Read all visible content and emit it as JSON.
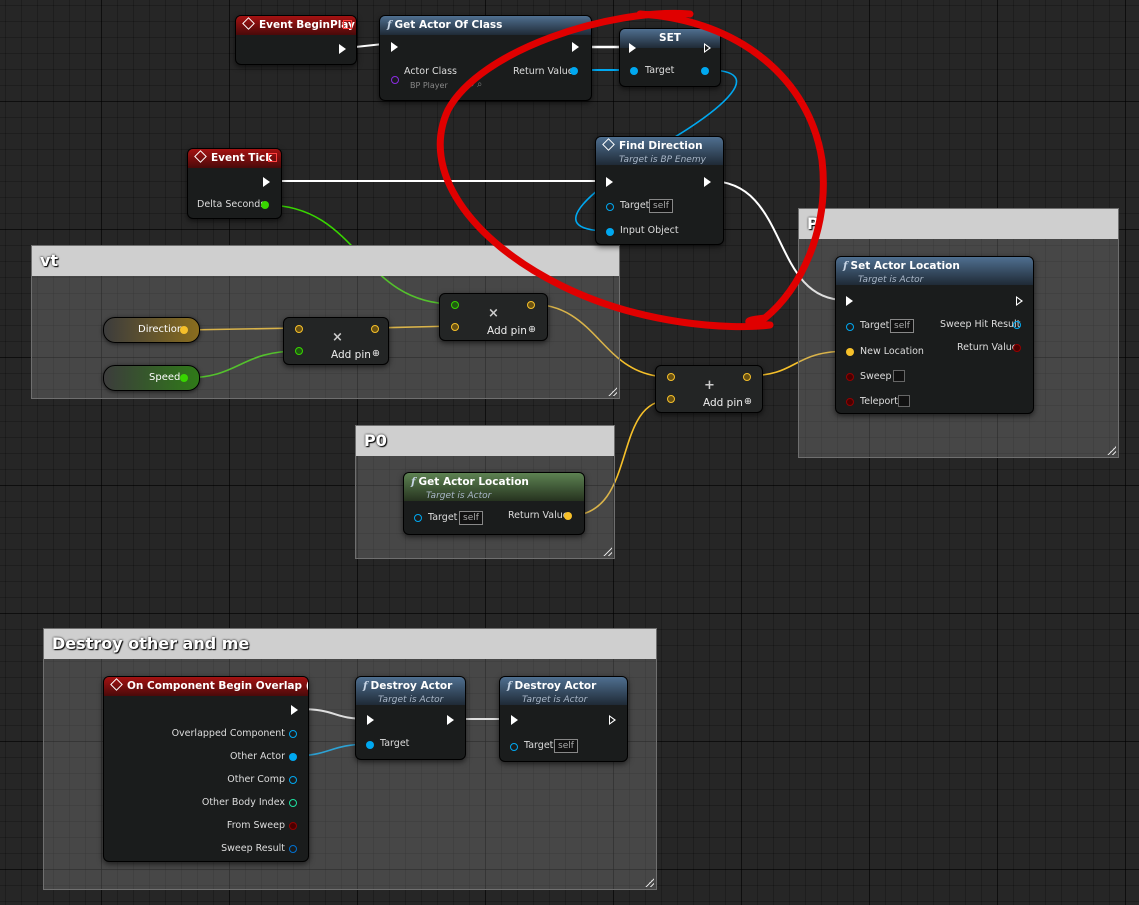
{
  "comments": {
    "vt": "vt",
    "p": "P",
    "p0": "P0",
    "destroy": "Destroy other and me"
  },
  "nodes": {
    "event_begin_play": {
      "title": "Event BeginPlay"
    },
    "get_actor_of_class": {
      "title": "Get Actor Of Class",
      "actor_class_label": "Actor Class",
      "actor_class_value": "BP Player",
      "return_value_label": "Return Value"
    },
    "set": {
      "title": "SET",
      "target_label": "Target"
    },
    "find_direction": {
      "title": "Find Direction",
      "subtitle": "Target is BP Enemy",
      "target_label": "Target",
      "target_value": "self",
      "input_object_label": "Input Object"
    },
    "event_tick": {
      "title": "Event Tick",
      "delta_seconds_label": "Delta Seconds"
    },
    "set_actor_location": {
      "title": "Set Actor Location",
      "subtitle": "Target is Actor",
      "target_label": "Target",
      "target_value": "self",
      "new_location_label": "New Location",
      "sweep_label": "Sweep",
      "teleport_label": "Teleport",
      "sweep_hit_result_label": "Sweep Hit Result",
      "return_value_label": "Return Value"
    },
    "get_actor_location": {
      "title": "Get Actor Location",
      "subtitle": "Target is Actor",
      "target_label": "Target",
      "target_value": "self",
      "return_value_label": "Return Value"
    },
    "on_component_begin_overlap": {
      "title": "On Component Begin Overlap (Box)",
      "pins": [
        "Overlapped Component",
        "Other Actor",
        "Other Comp",
        "Other Body Index",
        "From Sweep",
        "Sweep Result"
      ]
    },
    "destroy_actor_1": {
      "title": "Destroy Actor",
      "subtitle": "Target is Actor",
      "target_label": "Target"
    },
    "destroy_actor_2": {
      "title": "Destroy Actor",
      "subtitle": "Target is Actor",
      "target_label": "Target",
      "target_value": "self"
    }
  },
  "variables": {
    "direction": "Direction",
    "speed": "Speed"
  },
  "operators": {
    "multiply_sym": "×",
    "add_sym": "+",
    "add_pin_label": "Add pin"
  },
  "colors": {
    "exec": "#ffffff",
    "object": "#00a8f0",
    "vector": "#f6c02a",
    "float": "#38d500",
    "bool": "#950000",
    "annotation": "#e00000"
  }
}
